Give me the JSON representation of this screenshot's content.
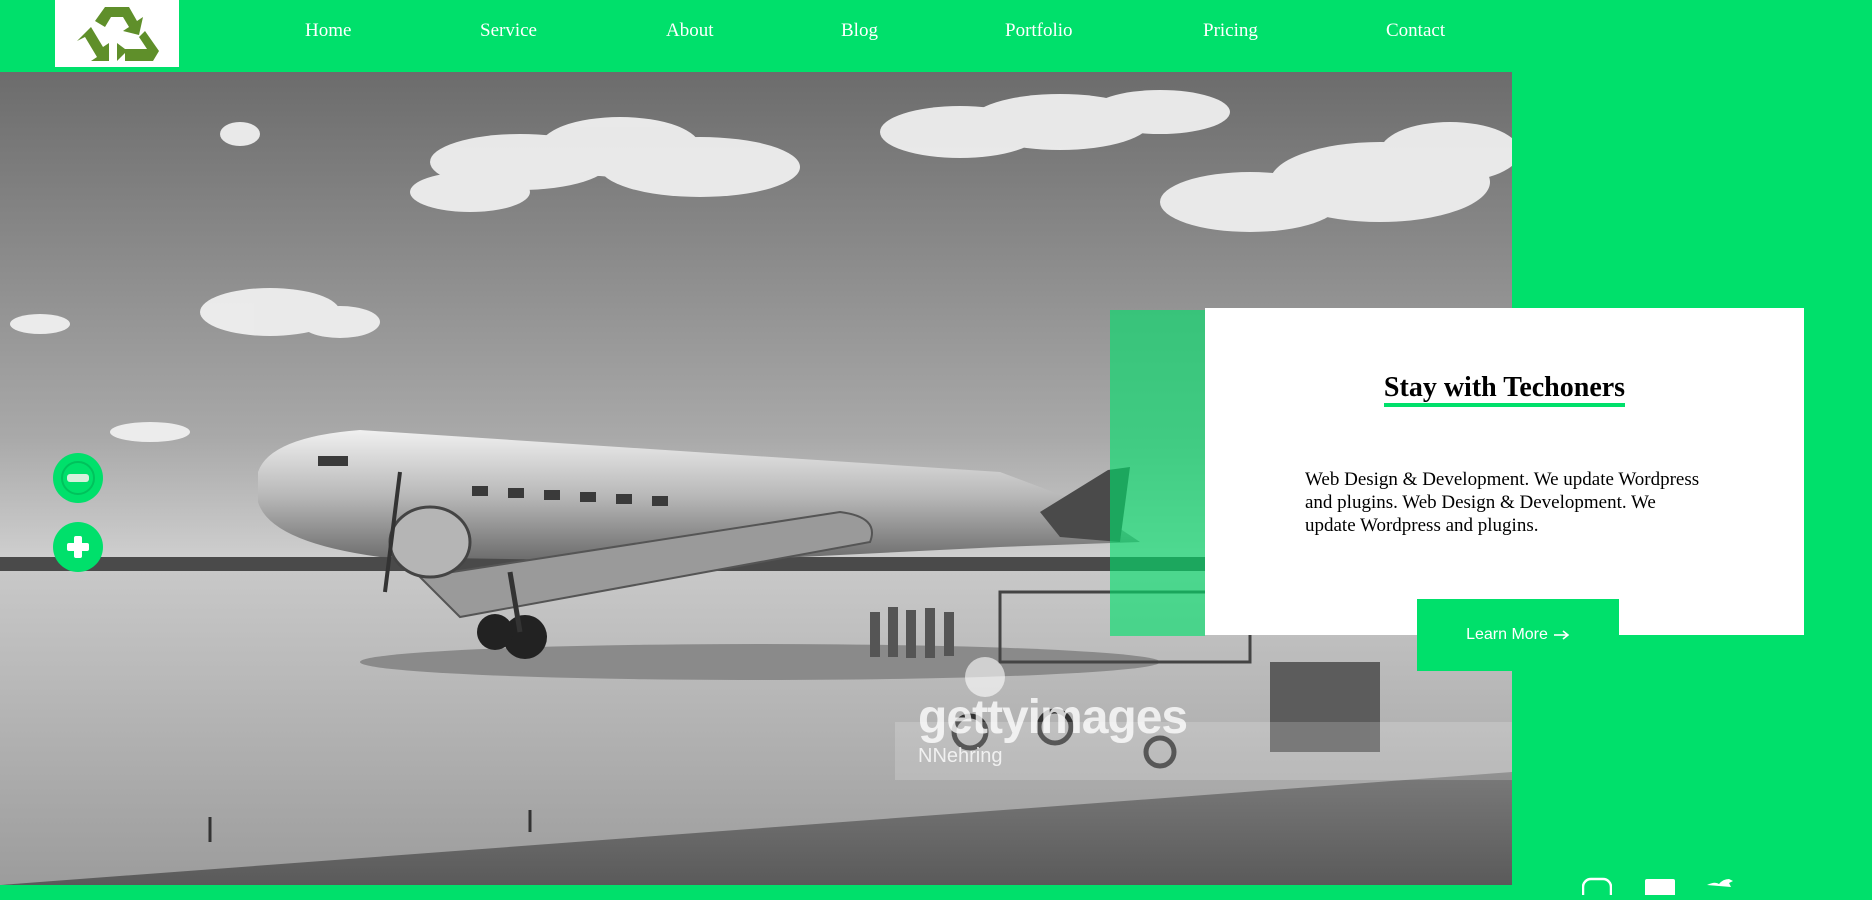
{
  "colors": {
    "accent": "#00e06b",
    "logo_green": "#5f8f2a"
  },
  "header": {
    "logo_icon": "recycle-icon",
    "nav": [
      {
        "label": "Home"
      },
      {
        "label": "Service"
      },
      {
        "label": "About"
      },
      {
        "label": "Blog"
      },
      {
        "label": "Portfolio"
      },
      {
        "label": "Pricing"
      },
      {
        "label": "Contact"
      }
    ]
  },
  "hero": {
    "image": "airplane-photo",
    "watermark_brand": "gettyimages",
    "watermark_credit": "NNehring",
    "zoom_out_icon": "minus-icon",
    "zoom_in_icon": "plus-icon"
  },
  "card": {
    "title": "Stay with Techoners",
    "text": "Web Design & Development. We update Wordpress and plugins. Web Design & Development. We update Wordpress and plugins.",
    "button_label": "Learn More",
    "button_icon": "arrow-right-icon"
  },
  "social": [
    "instagram-icon",
    "linkedin-icon",
    "twitter-icon"
  ]
}
